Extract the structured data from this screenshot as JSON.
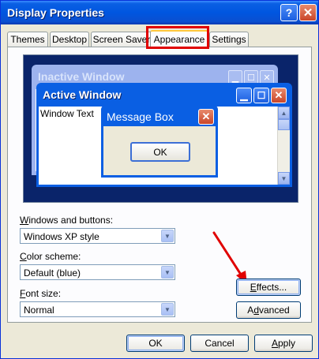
{
  "window": {
    "title": "Display Properties",
    "help_glyph": "?",
    "close_glyph": "✕"
  },
  "tabs": [
    {
      "label": "Themes",
      "active": false
    },
    {
      "label": "Desktop",
      "active": false
    },
    {
      "label": "Screen Saver",
      "active": false
    },
    {
      "label": "Appearance",
      "active": true
    },
    {
      "label": "Settings",
      "active": false
    }
  ],
  "preview": {
    "inactive_title": "Inactive Window",
    "active_title": "Active Window",
    "window_text": "Window Text",
    "message_box_title": "Message Box",
    "message_box_ok": "OK"
  },
  "fields": {
    "windows_buttons_label_key": "W",
    "windows_buttons_label_rest": "indows and buttons:",
    "windows_buttons_value": "Windows XP style",
    "color_scheme_label_key": "C",
    "color_scheme_label_rest": "olor scheme:",
    "color_scheme_value": "Default (blue)",
    "font_size_label_key": "F",
    "font_size_label_rest": "ont size:",
    "font_size_value": "Normal"
  },
  "buttons": {
    "effects_key": "E",
    "effects_rest": "ffects...",
    "advanced_key": "d",
    "advanced_pre": "A",
    "advanced_rest": "vanced",
    "ok": "OK",
    "cancel": "Cancel",
    "apply_key": "A",
    "apply_rest": "pply"
  },
  "colors": {
    "annotation": "#e00000",
    "title_blue": "#0a5fe3",
    "face": "#ece9d8"
  }
}
